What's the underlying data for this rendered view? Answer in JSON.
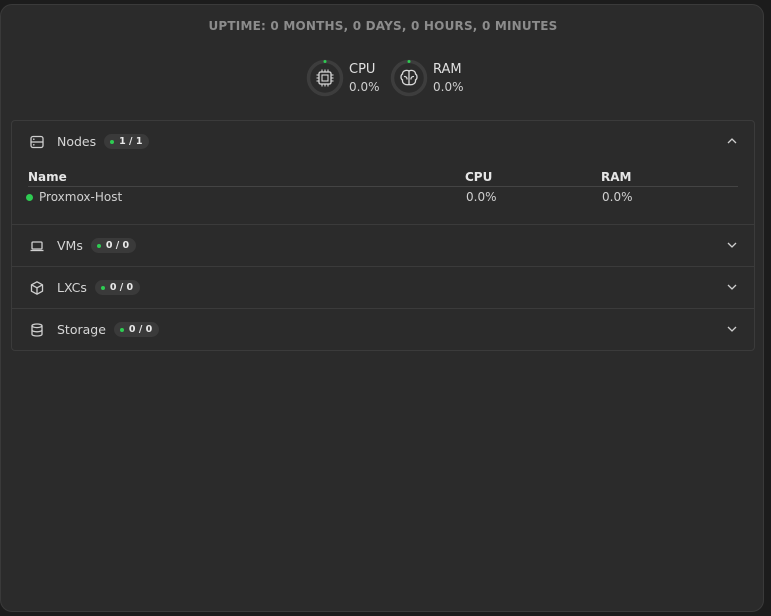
{
  "uptime": "UPTIME: 0 MONTHS, 0 DAYS, 0 HOURS, 0 MINUTES",
  "gauges": [
    {
      "label": "CPU",
      "value": "0.0%",
      "icon": "cpu-chip-icon",
      "fraction": 0.0
    },
    {
      "label": "RAM",
      "value": "0.0%",
      "icon": "brain-icon",
      "fraction": 0.0
    }
  ],
  "sections": {
    "nodes": {
      "title": "Nodes",
      "badge": "1 / 1",
      "icon": "server-icon",
      "expanded": true
    },
    "vms": {
      "title": "VMs",
      "badge": "0 / 0",
      "icon": "laptop-icon",
      "expanded": false
    },
    "lxcs": {
      "title": "LXCs",
      "badge": "0 / 0",
      "icon": "cube-icon",
      "expanded": false
    },
    "storage": {
      "title": "Storage",
      "badge": "0 / 0",
      "icon": "database-icon",
      "expanded": false
    }
  },
  "nodes_table": {
    "columns": [
      "Name",
      "CPU",
      "RAM"
    ],
    "rows": [
      {
        "name": "Proxmox-Host",
        "cpu": "0.0%",
        "ram": "0.0%",
        "status": "online"
      }
    ]
  },
  "colors": {
    "accent": "#2ecc52",
    "background": "#2b2b2b",
    "border": "#3b3b3b"
  }
}
